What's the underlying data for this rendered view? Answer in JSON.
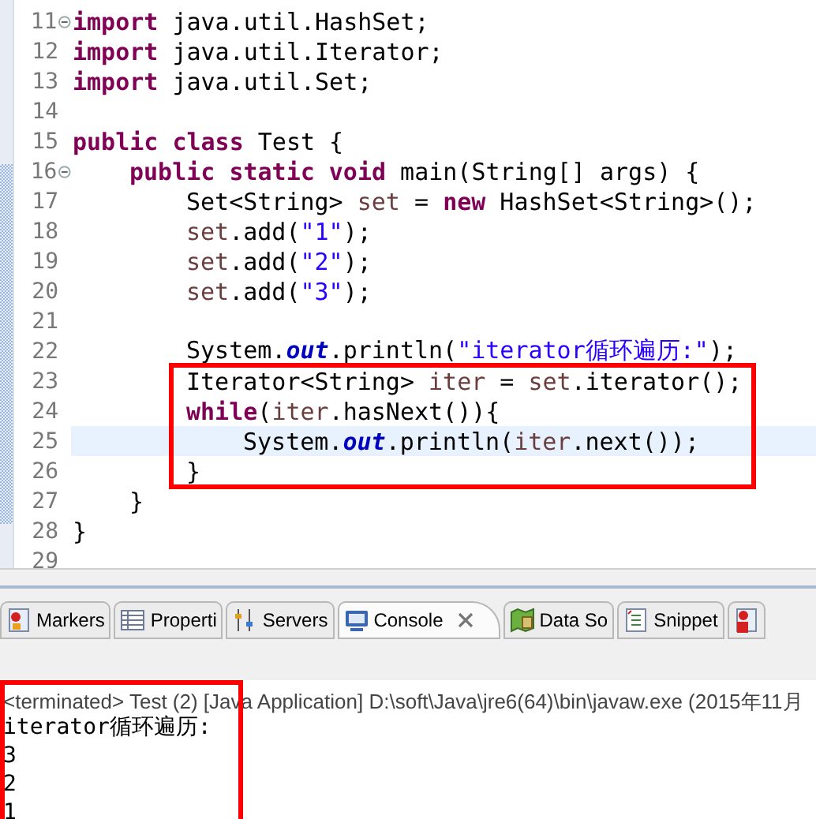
{
  "editor": {
    "lines": [
      {
        "number": "11",
        "foldable": true,
        "current": false,
        "tokens": [
          {
            "kind": "keyword",
            "text": "import"
          },
          {
            "kind": "plain",
            "text": " java.util.HashSet;"
          }
        ]
      },
      {
        "number": "12",
        "foldable": false,
        "current": false,
        "tokens": [
          {
            "kind": "keyword",
            "text": "import"
          },
          {
            "kind": "plain",
            "text": " java.util.Iterator;"
          }
        ]
      },
      {
        "number": "13",
        "foldable": false,
        "current": false,
        "tokens": [
          {
            "kind": "keyword",
            "text": "import"
          },
          {
            "kind": "plain",
            "text": " java.util.Set;"
          }
        ]
      },
      {
        "number": "14",
        "foldable": false,
        "current": false
      },
      {
        "number": "15",
        "foldable": false,
        "current": false,
        "tokens": [
          {
            "kind": "keyword",
            "text": "public"
          },
          {
            "kind": "keyword",
            "text": "class",
            "space_before": true
          },
          {
            "kind": "plain",
            "text": " Test {"
          }
        ],
        "children": [
          {
            "number": "16",
            "foldable": true,
            "current": false,
            "tokens": [
              {
                "kind": "keyword",
                "text": "public"
              },
              {
                "kind": "keyword",
                "text": "static",
                "space_before": true
              },
              {
                "kind": "keyword",
                "text": "void",
                "space_before": true
              },
              {
                "kind": "plain",
                "text": " main(String[] args) {"
              }
            ],
            "children": [
              {
                "number": "17",
                "foldable": false,
                "current": false,
                "tokens": [
                  {
                    "kind": "plain",
                    "text": "Set<String> "
                  },
                  {
                    "kind": "local",
                    "text": "set"
                  },
                  {
                    "kind": "plain",
                    "text": " = "
                  },
                  {
                    "kind": "keyword",
                    "text": "new"
                  },
                  {
                    "kind": "plain",
                    "text": " HashSet<String>();"
                  }
                ]
              },
              {
                "number": "18",
                "foldable": false,
                "current": false,
                "tokens": [
                  {
                    "kind": "local",
                    "text": "set"
                  },
                  {
                    "kind": "plain",
                    "text": ".add("
                  },
                  {
                    "kind": "string",
                    "text": "\"1\""
                  },
                  {
                    "kind": "plain",
                    "text": ");"
                  }
                ]
              },
              {
                "number": "19",
                "foldable": false,
                "current": false,
                "tokens": [
                  {
                    "kind": "local",
                    "text": "set"
                  },
                  {
                    "kind": "plain",
                    "text": ".add("
                  },
                  {
                    "kind": "string",
                    "text": "\"2\""
                  },
                  {
                    "kind": "plain",
                    "text": ");"
                  }
                ]
              },
              {
                "number": "20",
                "foldable": false,
                "current": false,
                "tokens": [
                  {
                    "kind": "local",
                    "text": "set"
                  },
                  {
                    "kind": "plain",
                    "text": ".add("
                  },
                  {
                    "kind": "string",
                    "text": "\"3\""
                  },
                  {
                    "kind": "plain",
                    "text": ");"
                  }
                ]
              },
              {
                "number": "21",
                "foldable": false,
                "current": false
              },
              {
                "number": "22",
                "foldable": false,
                "current": false,
                "tokens": [
                  {
                    "kind": "plain",
                    "text": "System."
                  },
                  {
                    "kind": "static",
                    "text": "out"
                  },
                  {
                    "kind": "plain",
                    "text": ".println("
                  },
                  {
                    "kind": "string",
                    "text": "\"iterator循环遍历:\""
                  },
                  {
                    "kind": "plain",
                    "text": ");"
                  }
                ]
              },
              {
                "number": "23",
                "foldable": false,
                "current": false,
                "tokens": [
                  {
                    "kind": "plain",
                    "text": "Iterator<String> "
                  },
                  {
                    "kind": "local",
                    "text": "iter"
                  },
                  {
                    "kind": "plain",
                    "text": " = "
                  },
                  {
                    "kind": "local",
                    "text": "set"
                  },
                  {
                    "kind": "plain",
                    "text": ".iterator();"
                  }
                ]
              },
              {
                "number": "24",
                "foldable": false,
                "current": false,
                "tokens": [
                  {
                    "kind": "keyword",
                    "text": "while"
                  },
                  {
                    "kind": "plain",
                    "text": "("
                  },
                  {
                    "kind": "local",
                    "text": "iter"
                  },
                  {
                    "kind": "plain",
                    "text": ".hasNext()){"
                  }
                ],
                "children": [
                  {
                    "number": "25",
                    "foldable": false,
                    "current": true,
                    "tokens": [
                      {
                        "kind": "plain",
                        "text": "System."
                      },
                      {
                        "kind": "static",
                        "text": "out"
                      },
                      {
                        "kind": "plain",
                        "text": ".println("
                      },
                      {
                        "kind": "local",
                        "text": "iter"
                      },
                      {
                        "kind": "plain",
                        "text": ".next());"
                      }
                    ]
                  }
                ]
              },
              {
                "number": "26",
                "foldable": false,
                "current": false,
                "tokens": [
                  {
                    "kind": "plain",
                    "text": "}"
                  }
                ]
              }
            ]
          },
          {
            "number": "27",
            "foldable": false,
            "current": false,
            "tokens": [
              {
                "kind": "plain",
                "text": "}"
              }
            ]
          }
        ]
      },
      {
        "number": "28",
        "foldable": false,
        "current": false,
        "tokens": [
          {
            "kind": "plain",
            "text": "}"
          }
        ]
      },
      {
        "number": "29",
        "foldable": false,
        "current": false
      }
    ]
  },
  "views": {
    "tabs": [
      {
        "label": "Markers",
        "selected": false
      },
      {
        "label": "Properti",
        "selected": false
      },
      {
        "label": "Servers",
        "selected": false
      },
      {
        "label": "Console",
        "selected": true
      },
      {
        "label": "Data So",
        "selected": false
      },
      {
        "label": "Snippet",
        "selected": false
      },
      {
        "selected": false
      }
    ]
  },
  "console": {
    "status": "<terminated> Test (2) [Java Application] D:\\soft\\Java\\jre6(64)\\bin\\javaw.exe (2015年11月",
    "output": [
      "iterator循环遍历:",
      "3",
      "2",
      "1"
    ]
  }
}
